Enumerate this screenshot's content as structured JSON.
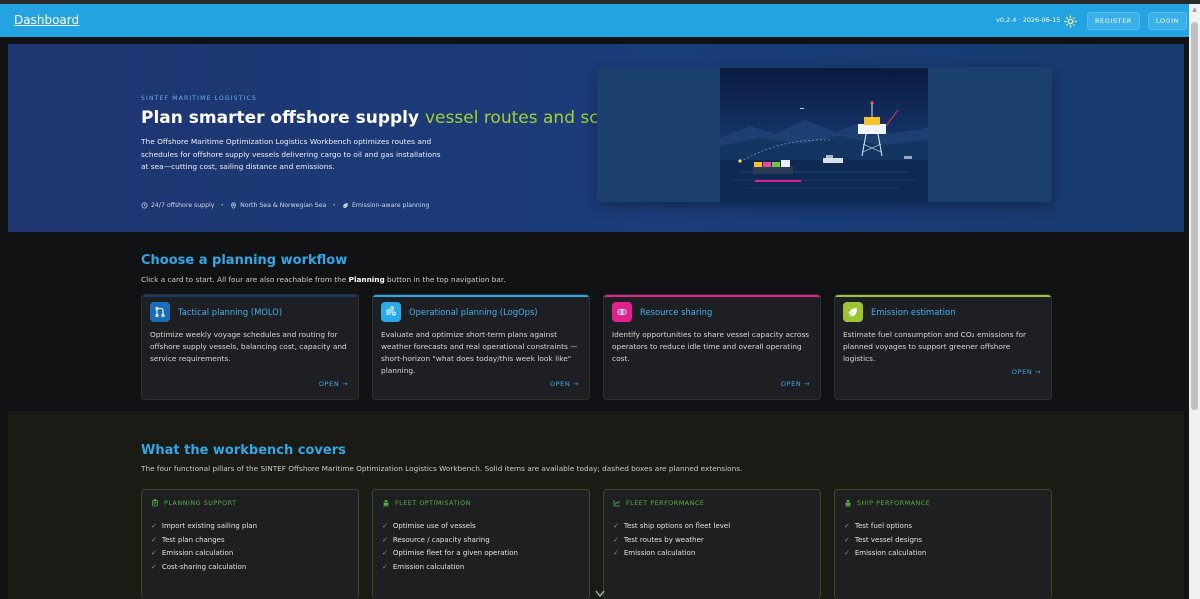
{
  "navbar": {
    "title": "Dashboard",
    "version": "v0.2.4 · 2026-06-15",
    "theme_icon": "sun-icon",
    "register_label": "REGISTER",
    "login_label": "LOGIN"
  },
  "hero": {
    "eyebrow": "SINTEF MARITIME LOGISTICS",
    "title_main": "Plan smarter offshore supply",
    "title_accent": "vessel routes and schedules.",
    "description": "The Offshore Maritime Optimization Logistics Workbench optimizes routes and schedules for offshore supply vessels delivering cargo to oil and gas installations at sea—cutting cost, sailing distance and emissions.",
    "features": [
      {
        "icon": "clock-icon",
        "label": "24/7 offshore supply"
      },
      {
        "icon": "location-pin-icon",
        "label": "North Sea & Norwegian Sea"
      },
      {
        "icon": "leaf-icon",
        "label": "Emission-aware planning"
      }
    ]
  },
  "workflow": {
    "title": "Choose a planning workflow",
    "subtitle_pre": "Click a card to start. All four are also reachable from the ",
    "subtitle_bold": "Planning",
    "subtitle_post": " button in the top navigation bar.",
    "cards": [
      {
        "title": "Tactical planning (MOLO)",
        "description": "Optimize weekly voyage schedules and routing for offshore supply vessels, balancing cost, capacity and service requirements.",
        "open_label": "OPEN",
        "icon": "route-icon",
        "color": "#1a6fb8"
      },
      {
        "title": "Operational planning (LogOps)",
        "description": "Evaluate and optimize short-term plans against weather forecasts and real operational constraints — short-horizon \"what does today/this week look like\" planning.",
        "open_label": "OPEN",
        "icon": "wind-icon",
        "color": "#29a9e8"
      },
      {
        "title": "Resource sharing",
        "description": "Identify opportunities to share vessel capacity across operators to reduce idle time and overall operating cost.",
        "open_label": "OPEN",
        "icon": "share-icon",
        "color": "#e2238f"
      },
      {
        "title": "Emission estimation",
        "description": "Estimate fuel consumption and CO₂ emissions for planned voyages to support greener offshore logistics.",
        "open_label": "OPEN",
        "icon": "leaf-icon",
        "color": "#9cc531"
      }
    ]
  },
  "covers": {
    "title": "What the workbench covers",
    "subtitle": "The four functional pillars of the SINTEF Offshore Maritime Optimization Logistics Workbench. Solid items are available today; dashed boxes are planned extensions.",
    "pillars": [
      {
        "title": "PLANNING SUPPORT",
        "icon": "clipboard-icon",
        "items": [
          "Import existing sailing plan",
          "Test plan changes",
          "Emission calculation",
          "Cost-sharing calculation"
        ]
      },
      {
        "title": "FLEET OPTIMISATION",
        "icon": "ship-icon",
        "items": [
          "Optimise use of vessels",
          "Resource / capacity sharing",
          "Optimise fleet for a given operation",
          "Emission calculation"
        ]
      },
      {
        "title": "FLEET PERFORMANCE",
        "icon": "line-chart-icon",
        "items": [
          "Test ship options on fleet level",
          "Test routes by weather",
          "Emission calculation"
        ]
      },
      {
        "title": "SHIP PERFORMANCE",
        "icon": "ship-icon",
        "items": [
          "Test fuel options",
          "Test vessel designs",
          "Emission calculation"
        ]
      }
    ]
  }
}
